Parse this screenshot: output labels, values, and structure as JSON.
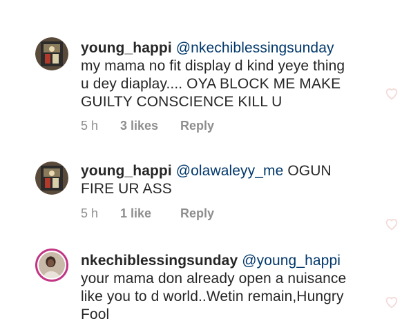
{
  "comments": [
    {
      "username": "young_happi",
      "mention": "@nkechiblessingsunday",
      "text_lines": [
        "my mama no fit display d kind yeye thing",
        "u dey diaplay.... OYA BLOCK ME MAKE",
        "GUILTY CONSCIENCE KILL U"
      ],
      "time": "5 h",
      "likes": "3 likes",
      "reply": "Reply",
      "avatar_icon": "profile-photo"
    },
    {
      "username": "young_happi",
      "mention": "@olawaleyy_me",
      "text_first": "OGUN",
      "text_lines": [
        "FIRE UR ASS"
      ],
      "time": "5 h",
      "likes": "1 like",
      "reply": "Reply",
      "avatar_icon": "profile-photo"
    },
    {
      "username": "nkechiblessingsunday",
      "mention": "@young_happi",
      "text_lines": [
        "your mama don already open a nuisance",
        "like you to d world..Wetin remain,Hungry",
        "Fool"
      ],
      "avatar_icon": "profile-photo-with-story-ring"
    }
  ],
  "icons": {
    "like": "heart-icon"
  },
  "colors": {
    "text": "#262626",
    "mention": "#00376b",
    "meta": "#8e8e8e",
    "story_ring": "#c13584"
  }
}
